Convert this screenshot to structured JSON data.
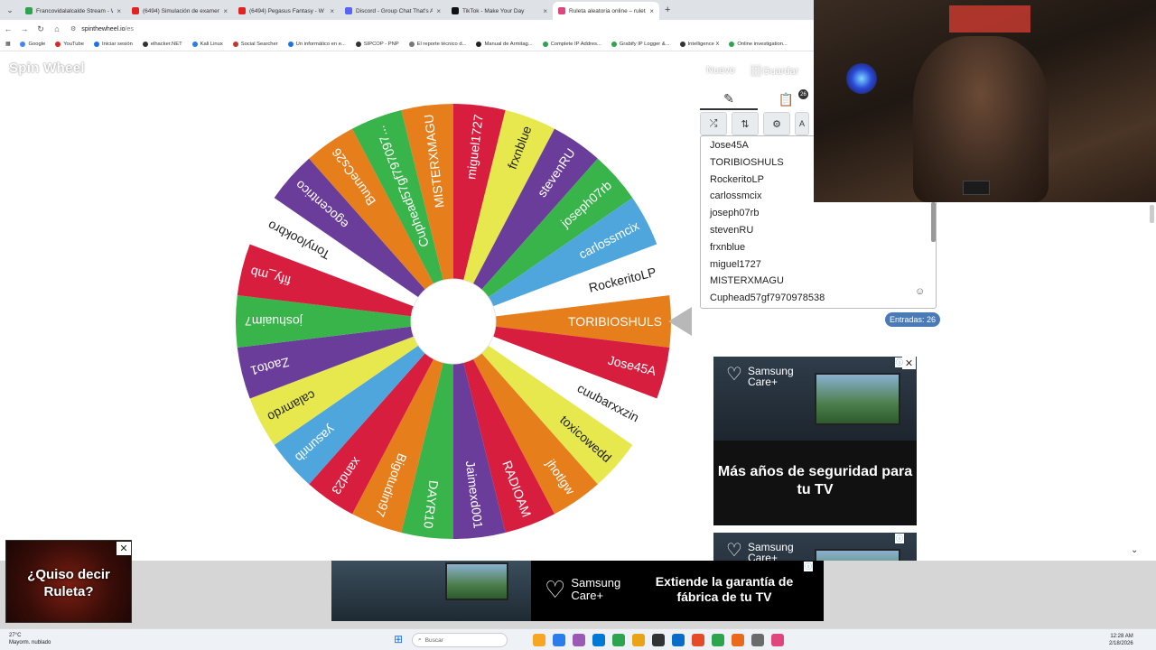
{
  "browser": {
    "tabs": [
      {
        "title": "Francovidalalcalde Stream - Wa",
        "color": "#2ea44f",
        "active": false
      },
      {
        "title": "(6494) Simulación de examen E",
        "color": "#e02424",
        "active": false
      },
      {
        "title": "(6494) Pegasus Fantasy - W",
        "color": "#e02424",
        "active": false
      },
      {
        "title": "Discord - Group Chat That's All",
        "color": "#5865f2",
        "active": false
      },
      {
        "title": "TikTok - Make Your Day",
        "color": "#111111",
        "active": false
      },
      {
        "title": "Ruleta aleatoria online – ruleta",
        "color": "#e0457b",
        "active": true
      }
    ],
    "url_host": "spinthewheel.io",
    "url_path": "/es",
    "bookmarks": [
      "Google",
      "YouTube",
      "Iniciar sesión",
      "elhacker.NET",
      "Kali Linux",
      "Social Searcher",
      "Un informático en e...",
      "SIPCOP - PNP",
      "El reporte técnico d...",
      "Manual de Armitag...",
      "Complete IP Addres...",
      "Grabify IP Logger &...",
      "Intelligence X",
      "Online investigation..."
    ]
  },
  "page": {
    "logo": "Spin Wheel",
    "new_label": "Nuevo",
    "save_label": "Guardar"
  },
  "wheel": {
    "segments": [
      {
        "label": "TORIBIOSHULS",
        "color": "#e57e1b"
      },
      {
        "label": "Jose45A",
        "color": "#d81e3e"
      },
      {
        "label": "cuubarxxzin",
        "color": "#ffffff"
      },
      {
        "label": "toxicowedd",
        "color": "#e7e84e"
      },
      {
        "label": "jhotlgw",
        "color": "#e57e1b"
      },
      {
        "label": "RADIOAM",
        "color": "#d81e3e"
      },
      {
        "label": "Jaimexd001",
        "color": "#6a3d9a"
      },
      {
        "label": "DAYR10",
        "color": "#38b44a"
      },
      {
        "label": "Bigotudin97",
        "color": "#e57e1b"
      },
      {
        "label": "xand23",
        "color": "#d81e3e"
      },
      {
        "label": "yasunrib",
        "color": "#4ea6dc"
      },
      {
        "label": "calamrdo",
        "color": "#e7e84e"
      },
      {
        "label": "Zaoto1",
        "color": "#6a3d9a"
      },
      {
        "label": "joshuaim7",
        "color": "#38b44a"
      },
      {
        "label": "fify_mb",
        "color": "#d81e3e"
      },
      {
        "label": "Tonylookbro",
        "color": "#ffffff"
      },
      {
        "label": "egocentrico",
        "color": "#6a3d9a"
      },
      {
        "label": "BuuneCs26",
        "color": "#e57e1b"
      },
      {
        "label": "Cuphead57gf797097...",
        "color": "#38b44a"
      },
      {
        "label": "MISTERXMAGU",
        "color": "#e57e1b"
      },
      {
        "label": "miguel1727",
        "color": "#d81e3e"
      },
      {
        "label": "frxnblue",
        "color": "#e7e84e"
      },
      {
        "label": "stevenRU",
        "color": "#6a3d9a"
      },
      {
        "label": "joseph07rb",
        "color": "#38b44a"
      },
      {
        "label": "carlossmcix",
        "color": "#4ea6dc"
      },
      {
        "label": "RockeritoLP",
        "color": "#ffffff"
      }
    ]
  },
  "panel": {
    "entries": [
      "Jose45A",
      "TORIBIOSHULS",
      "RockeritoLP",
      "carlossmcix",
      "joseph07rb",
      "stevenRU",
      "frxnblue",
      "miguel1727",
      "MISTERXMAGU",
      "Cuphead57gf7970978538"
    ],
    "count_label": "Entradas: 26",
    "tab_badge": "26",
    "partial_button": "A"
  },
  "ads": {
    "brand_line1": "Samsung",
    "brand_line2": "Care+",
    "side_headline": "Más años de seguridad para tu TV",
    "banner_headline": "Extiende la garantía de fábrica de tu TV",
    "popup_text": "¿Quiso decir Ruleta?"
  },
  "taskbar": {
    "temperature": "27°C",
    "weather": "Mayorm. nublado",
    "search_placeholder": "Buscar",
    "time": "12:28 AM",
    "date": "2/18/2026",
    "app_colors": [
      "#f6a623",
      "#2b7de9",
      "#9b59b6",
      "#0078d4",
      "#2ea44f",
      "#e8a317",
      "#333333",
      "#0a6cc9",
      "#e34c26",
      "#2ea44f",
      "#e86a1a",
      "#6b6b6b",
      "#e0457b"
    ]
  }
}
